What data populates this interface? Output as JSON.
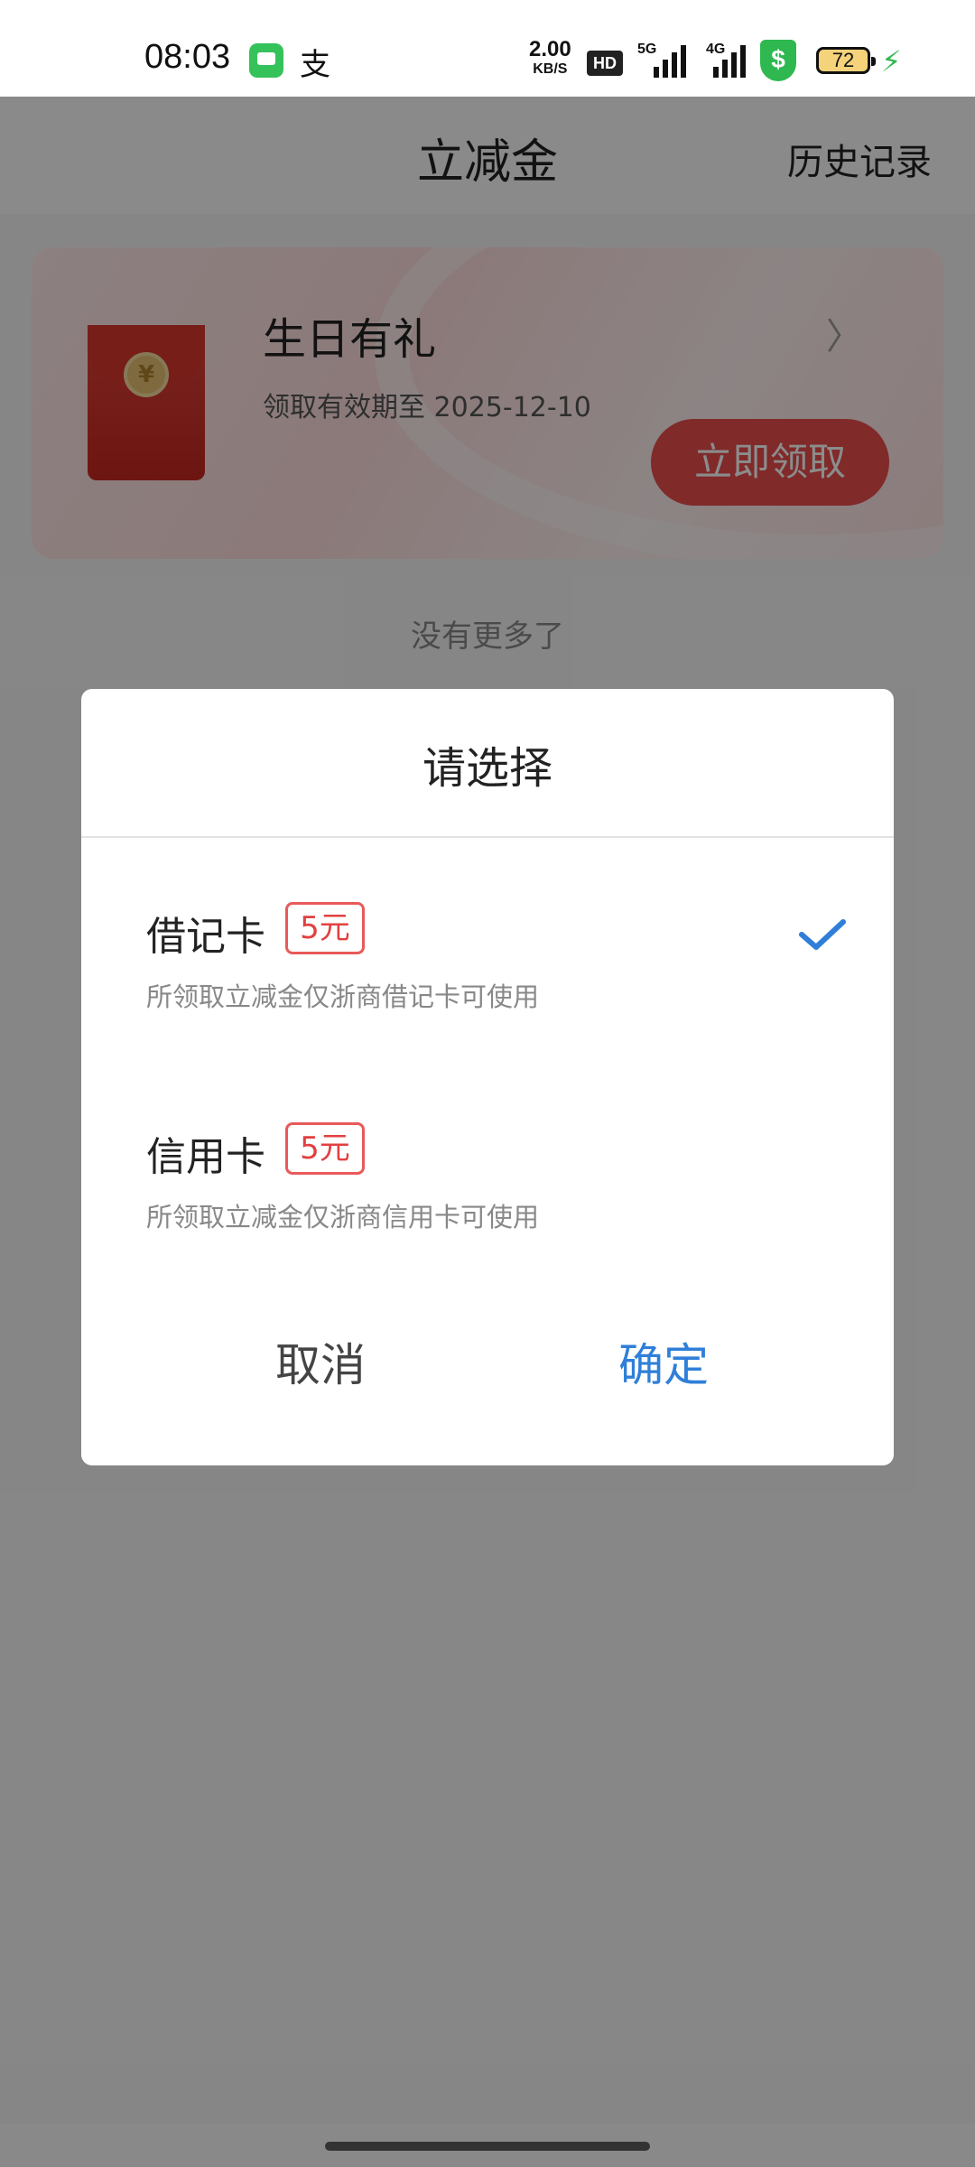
{
  "status_bar": {
    "time": "08:03",
    "alipay_glyph": "支",
    "net_speed": "2.00",
    "net_unit": "KB/S",
    "hd": "HD",
    "sim1": "5G",
    "sim2": "4G",
    "shield_glyph": "$",
    "battery": "72",
    "bolt": "⚡",
    "icons": [
      "messages-app-icon",
      "alipay-icon",
      "hd-icon",
      "signal-icon",
      "signal-icon",
      "security-shield-icon",
      "battery-icon",
      "charging-icon"
    ]
  },
  "header": {
    "title": "立减金",
    "history_link": "历史记录"
  },
  "card": {
    "title": "生日有礼",
    "chevron": "〉",
    "expiry": "领取有效期至 2025-12-10",
    "button": "立即领取",
    "coin_glyph": "¥"
  },
  "list_footer": "没有更多了",
  "dialog": {
    "title": "请选择",
    "options": [
      {
        "label": "借记卡",
        "badge": "5元",
        "desc": "所领取立减金仅浙商借记卡可使用",
        "selected": true
      },
      {
        "label": "信用卡",
        "badge": "5元",
        "desc": "所领取立减金仅浙商信用卡可使用",
        "selected": false
      }
    ],
    "cancel": "取消",
    "confirm": "确定"
  },
  "colors": {
    "accent_blue": "#2f7fd9",
    "accent_red": "#e24040",
    "overlay": "rgba(0,0,0,0.45)"
  }
}
